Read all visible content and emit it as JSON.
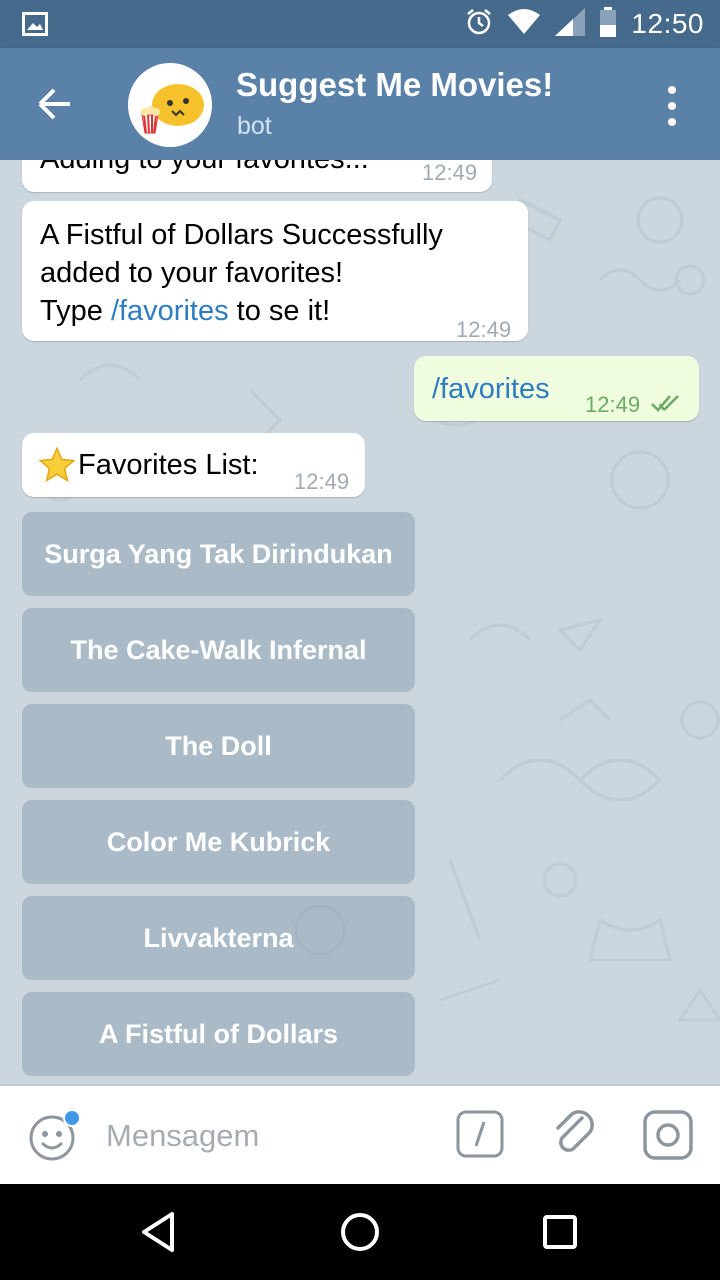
{
  "status_bar": {
    "time": "12:50",
    "icons": [
      "image-icon",
      "alarm-icon",
      "wifi-icon",
      "signal-icon",
      "battery-icon"
    ]
  },
  "header": {
    "title": "Suggest Me Movies!",
    "subtitle": "bot",
    "back_icon": "arrow-left-icon",
    "menu_icon": "more-vert-icon"
  },
  "messages": [
    {
      "direction": "in",
      "text": "Adding to your favorites...",
      "time": "12:49"
    },
    {
      "direction": "in",
      "line1": "A Fistful of Dollars  Successfully",
      "line2": "added to your favorites!",
      "line3_pre": "Type ",
      "line3_link": "/favorites",
      "line3_post": " to se it!",
      "time": "12:49"
    },
    {
      "direction": "out",
      "text": "/favorites",
      "time": "12:49",
      "status_icon": "double-check-icon"
    },
    {
      "direction": "in",
      "emoji": "star-icon",
      "text": "Favorites List:",
      "time": "12:49"
    }
  ],
  "keyboard": {
    "buttons": [
      "Surga Yang Tak Dirindukan",
      "The Cake-Walk Infernal",
      "The Doll",
      "Color Me Kubrick",
      "Livvakterna",
      "A Fistful of Dollars"
    ]
  },
  "input": {
    "placeholder": "Mensagem",
    "value": ""
  },
  "nav": {
    "icons": [
      "back-triangle-icon",
      "home-circle-icon",
      "recents-square-icon"
    ]
  },
  "colors": {
    "header": "#5a81a8",
    "status_bar": "#456a8c",
    "link": "#2e7cc2",
    "out_bubble": "#effdde",
    "check": "#6bab66"
  }
}
